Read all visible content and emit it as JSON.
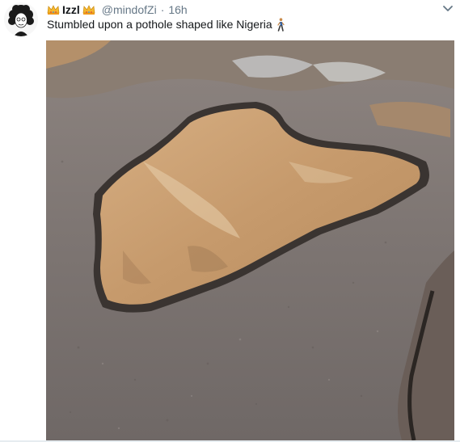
{
  "tweet": {
    "display_name": "Izzl",
    "handle": "@mindofZi",
    "separator": "·",
    "time": "16h",
    "text": "Stumbled upon a pothole shaped like Nigeria",
    "emoji_name": "person-walking-icon",
    "name_emoji_name": "crown-icon"
  },
  "colors": {
    "road": "#7f7774",
    "water": "#c49a6f",
    "handle_gray": "#657786"
  }
}
